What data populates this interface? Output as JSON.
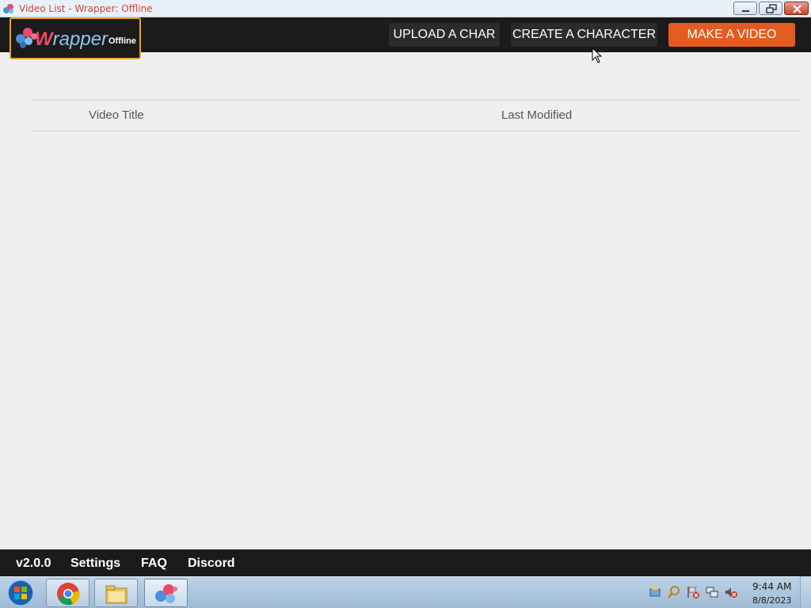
{
  "window": {
    "title": "Video List - Wrapper: Offline"
  },
  "header": {
    "logo_text": "Wrapper",
    "logo_suffix": "Offline",
    "upload_label": "UPLOAD A CHAR",
    "create_label": "CREATE A CHARACTER",
    "make_label": "MAKE A VIDEO"
  },
  "list": {
    "columns": [
      "Video Title",
      "Last Modified"
    ]
  },
  "footer": {
    "version": "v2.0.0",
    "settings": "Settings",
    "faq": "FAQ",
    "discord": "Discord"
  },
  "taskbar": {
    "time": "9:44 AM",
    "date": "8/8/2023"
  },
  "colors": {
    "accent": "#e35b1f",
    "header_bg": "#1b1b1b",
    "logo_border": "#e5a52b",
    "title_text": "#e0432f"
  }
}
